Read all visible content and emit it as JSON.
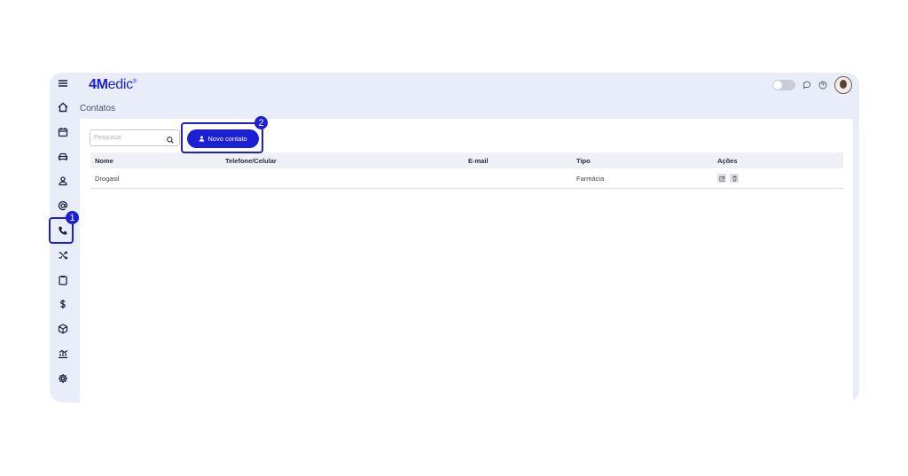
{
  "app": {
    "logo_bold": "4M",
    "logo_light": "edic",
    "logo_mark": "®"
  },
  "page": {
    "title": "Contatos"
  },
  "sidebar": {
    "items": [
      {
        "name": "menu-icon"
      },
      {
        "name": "home-icon"
      },
      {
        "name": "calendar-icon"
      },
      {
        "name": "car-icon"
      },
      {
        "name": "user-icon"
      },
      {
        "name": "at-sign-icon"
      },
      {
        "name": "phone-icon",
        "active": true
      },
      {
        "name": "shuffle-icon"
      },
      {
        "name": "clipboard-icon"
      },
      {
        "name": "dollar-icon"
      },
      {
        "name": "box-icon"
      },
      {
        "name": "chart-icon"
      },
      {
        "name": "settings-icon"
      }
    ]
  },
  "toolbar": {
    "search_placeholder": "Pesquisar",
    "new_contact_label": "Novo contato"
  },
  "table": {
    "headers": [
      "Nome",
      "Telefone/Celular",
      "E-mail",
      "Tipo",
      "Ações"
    ],
    "rows": [
      {
        "nome": "Drogasil",
        "telefone": "",
        "email": "",
        "tipo": "Farmácia"
      }
    ]
  },
  "markers": [
    "1",
    "2"
  ],
  "colors": {
    "accent": "#1b1fd6",
    "app_bg": "#e8edf9"
  }
}
